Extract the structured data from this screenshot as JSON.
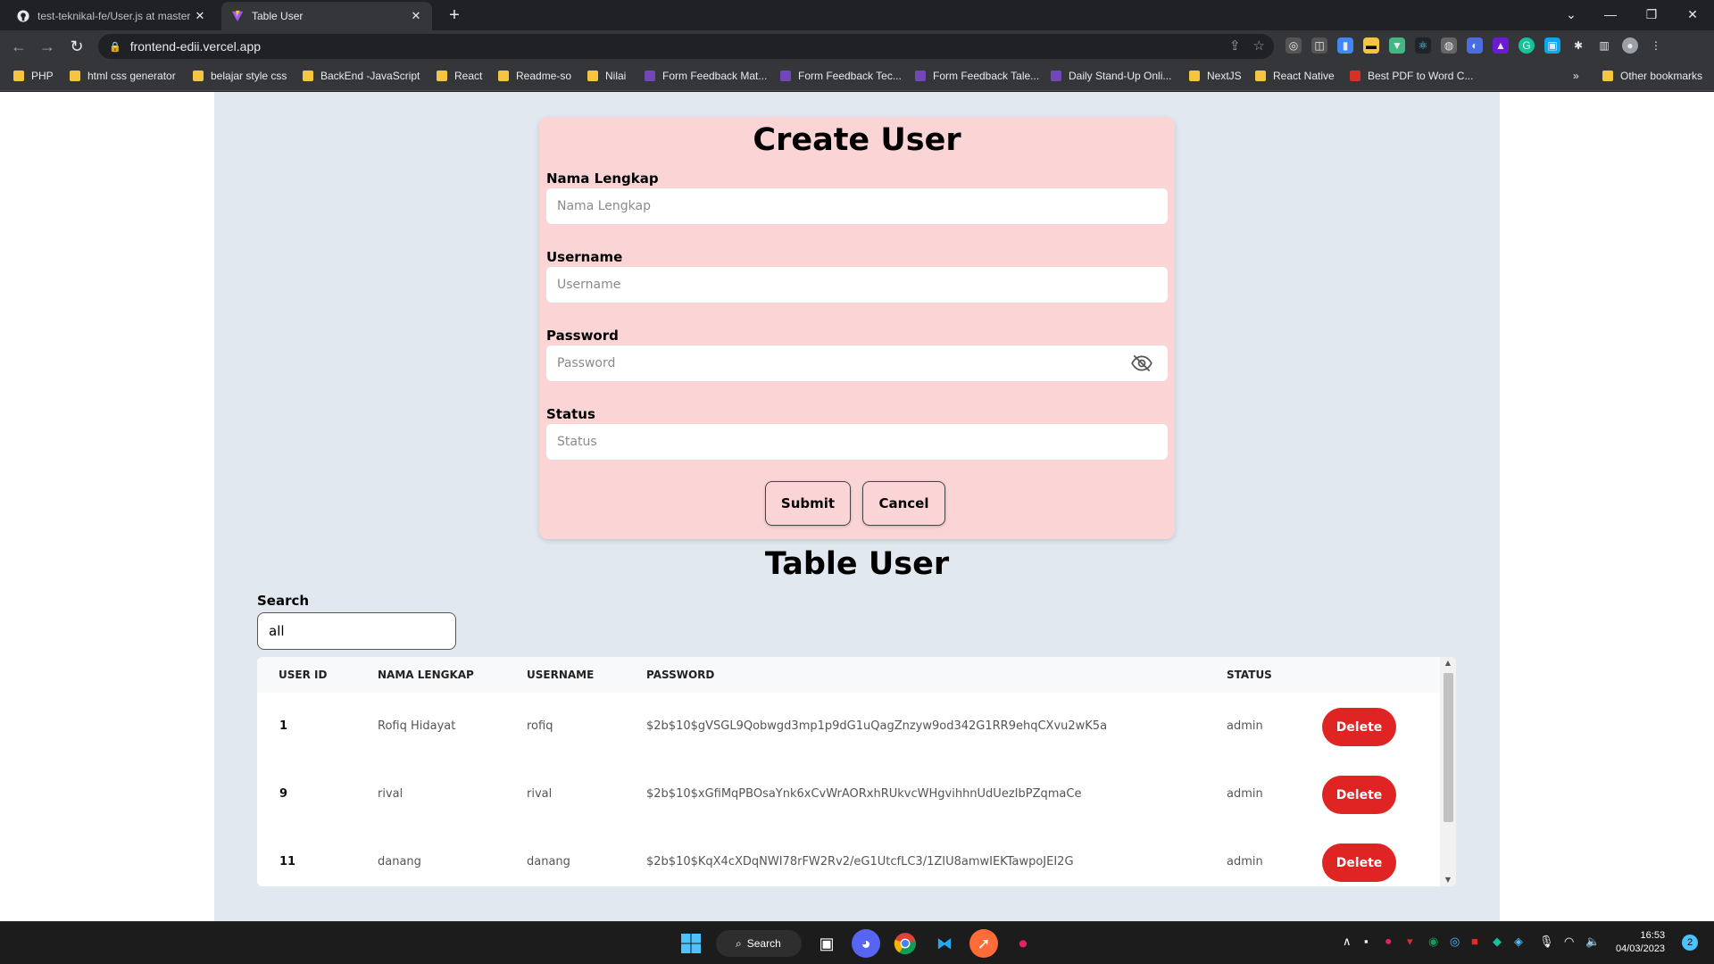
{
  "browser": {
    "tabs": [
      {
        "title": "test-teknikal-fe/User.js at master",
        "active": false,
        "icon": "github-icon"
      },
      {
        "title": "Table User",
        "active": true,
        "icon": "vite-icon"
      }
    ],
    "url": "frontend-edii.vercel.app",
    "bookmarks": [
      "PHP",
      "html css generator",
      "belajar style css",
      "BackEnd -JavaScript",
      "React",
      "Readme-so",
      "Nilai",
      "Form Feedback Mat...",
      "Form Feedback Tec...",
      "Form Feedback Tale...",
      "Daily Stand-Up Onli...",
      "NextJS",
      "React Native",
      "Best PDF to Word C..."
    ],
    "other_bookmarks": "Other bookmarks"
  },
  "create_form": {
    "title": "Create User",
    "fields": [
      {
        "label": "Nama Lengkap",
        "placeholder": "Nama Lengkap",
        "value": ""
      },
      {
        "label": "Username",
        "placeholder": "Username",
        "value": ""
      },
      {
        "label": "Password",
        "placeholder": "Password",
        "value": ""
      },
      {
        "label": "Status",
        "placeholder": "Status",
        "value": ""
      }
    ],
    "submit_label": "Submit",
    "cancel_label": "Cancel"
  },
  "table": {
    "title": "Table User",
    "search_label": "Search",
    "search_value": "all",
    "columns": [
      "USER ID",
      "NAMA LENGKAP",
      "USERNAME",
      "PASSWORD",
      "STATUS"
    ],
    "rows": [
      {
        "id": "1",
        "nama": "Rofiq Hidayat",
        "username": "rofiq",
        "password": "$2b$10$gVSGL9Qobwgd3mp1p9dG1uQagZnzyw9od342G1RR9ehqCXvu2wK5a",
        "status": "admin",
        "action": "Delete"
      },
      {
        "id": "9",
        "nama": "rival",
        "username": "rival",
        "password": "$2b$10$xGfiMqPBOsaYnk6xCvWrAORxhRUkvcWHgvihhnUdUezIbPZqmaCe",
        "status": "admin",
        "action": "Delete"
      },
      {
        "id": "11",
        "nama": "danang",
        "username": "danang",
        "password": "$2b$10$KqX4cXDqNWI78rFW2Rv2/eG1UtcfLC3/1ZIU8amwIEKTawpoJEI2G",
        "status": "admin",
        "action": "Delete"
      }
    ]
  },
  "taskbar": {
    "search_label": "Search",
    "time": "16:53",
    "date": "04/03/2023",
    "notification_count": "2"
  },
  "colors": {
    "card_bg": "#fbd5d5",
    "content_bg": "#e2e8f0",
    "delete_red": "#e02424"
  }
}
